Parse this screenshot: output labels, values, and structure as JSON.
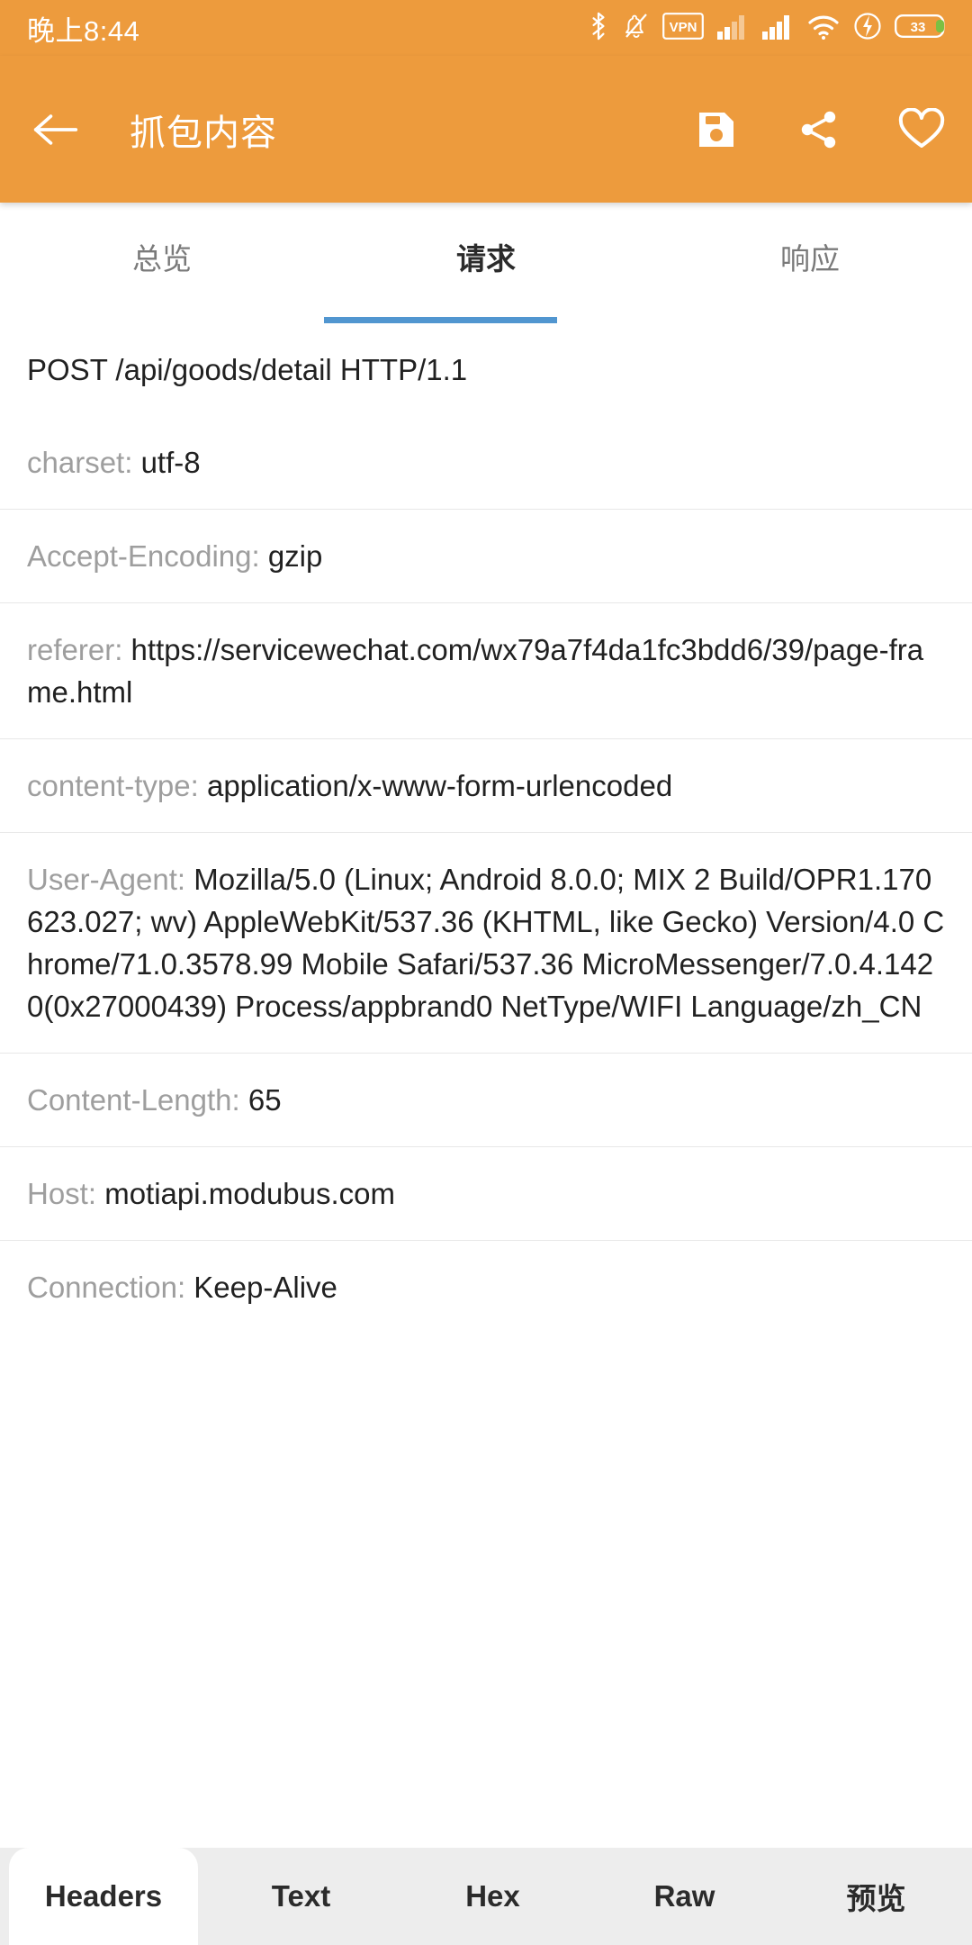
{
  "status_bar": {
    "clock": "晚上8:44",
    "battery_level": "33",
    "icons": [
      "bluetooth-icon",
      "notifications-muted-icon",
      "vpn-icon",
      "signal-1-icon",
      "signal-2-icon",
      "wifi-icon",
      "charging-bolt-icon",
      "battery-icon"
    ]
  },
  "toolbar": {
    "back_icon": "back-arrow-icon",
    "title": "抓包内容",
    "actions": [
      {
        "name": "save-icon",
        "label": "保存"
      },
      {
        "name": "share-icon",
        "label": "分享"
      },
      {
        "name": "favorite-icon",
        "label": "收藏"
      }
    ]
  },
  "top_tabs": {
    "items": [
      {
        "label": "总览",
        "active": false
      },
      {
        "label": "请求",
        "active": true
      },
      {
        "label": "响应",
        "active": false
      }
    ],
    "indicator_color": "#5196D0"
  },
  "headers": [
    {
      "key": "",
      "value": "POST /api/goods/detail HTTP/1.1",
      "divider": false
    },
    {
      "key": "charset",
      "value": "utf-8",
      "divider": false
    },
    {
      "key": "Accept-Encoding",
      "value": "gzip",
      "divider": true
    },
    {
      "key": "referer",
      "value": "https://servicewechat.com/wx79a7f4da1fc3bdd6/39/page-frame.html",
      "divider": true
    },
    {
      "key": "content-type",
      "value": "application/x-www-form-urlencoded",
      "divider": true
    },
    {
      "key": "User-Agent",
      "value": "Mozilla/5.0 (Linux; Android 8.0.0; MIX 2 Build/OPR1.170623.027; wv) AppleWebKit/537.36 (KHTML, like Gecko) Version/4.0 Chrome/71.0.3578.99 Mobile Safari/537.36 MicroMessenger/7.0.4.1420(0x27000439) Process/appbrand0 NetType/WIFI Language/zh_CN",
      "divider": true
    },
    {
      "key": "Content-Length",
      "value": "65",
      "divider": true
    },
    {
      "key": "Host",
      "value": "motiapi.modubus.com",
      "divider": true
    },
    {
      "key": "Connection",
      "value": "Keep-Alive",
      "divider": true
    }
  ],
  "bottom_tabs": {
    "items": [
      {
        "label": "Headers",
        "active": true
      },
      {
        "label": "Text",
        "active": false
      },
      {
        "label": "Hex",
        "active": false
      },
      {
        "label": "Raw",
        "active": false
      },
      {
        "label": "预览",
        "active": false
      }
    ]
  },
  "colors": {
    "accent_orange": "#ED9B3D",
    "tab_indicator_blue": "#5196D0",
    "key_gray": "#9E9E9E",
    "value_black": "#212121",
    "bottom_bar_gray": "#EDEDED"
  }
}
